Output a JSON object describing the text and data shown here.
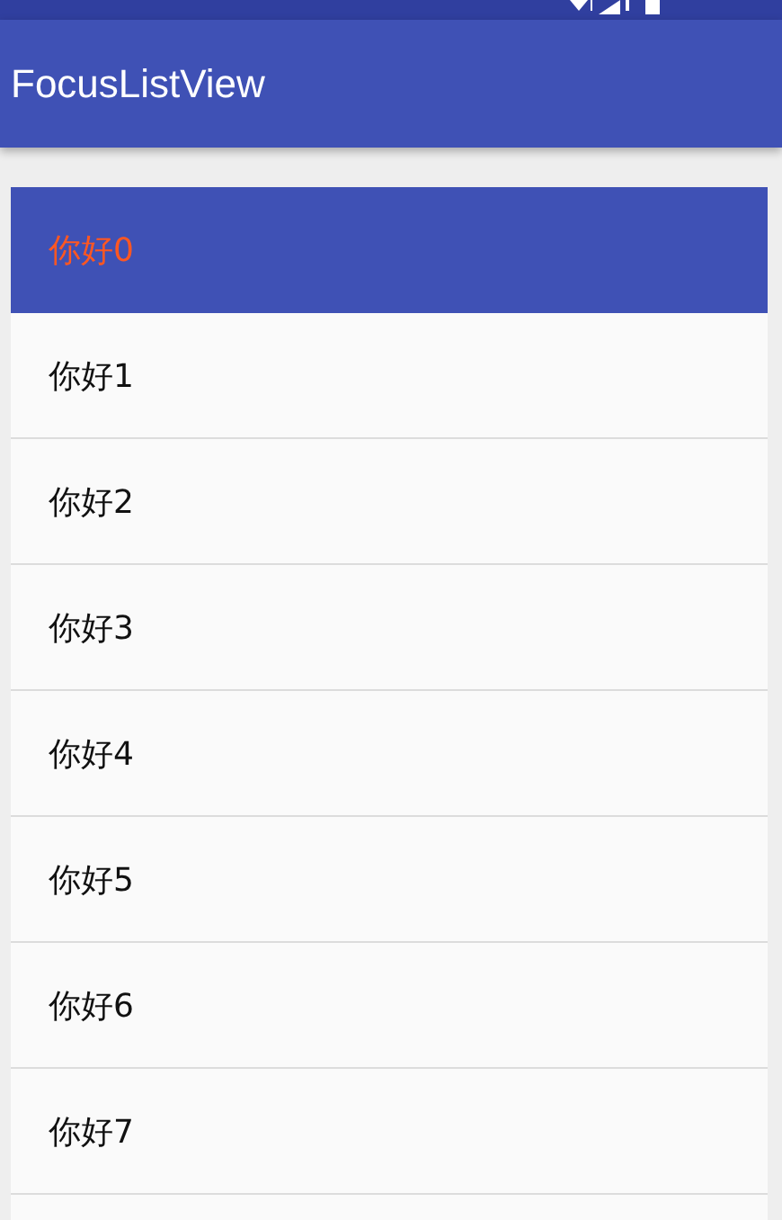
{
  "app_bar": {
    "title": "FocusListView"
  },
  "list": {
    "items": [
      {
        "label": "你好0",
        "selected": true
      },
      {
        "label": "你好1",
        "selected": false
      },
      {
        "label": "你好2",
        "selected": false
      },
      {
        "label": "你好3",
        "selected": false
      },
      {
        "label": "你好4",
        "selected": false
      },
      {
        "label": "你好5",
        "selected": false
      },
      {
        "label": "你好6",
        "selected": false
      },
      {
        "label": "你好7",
        "selected": false
      }
    ]
  }
}
